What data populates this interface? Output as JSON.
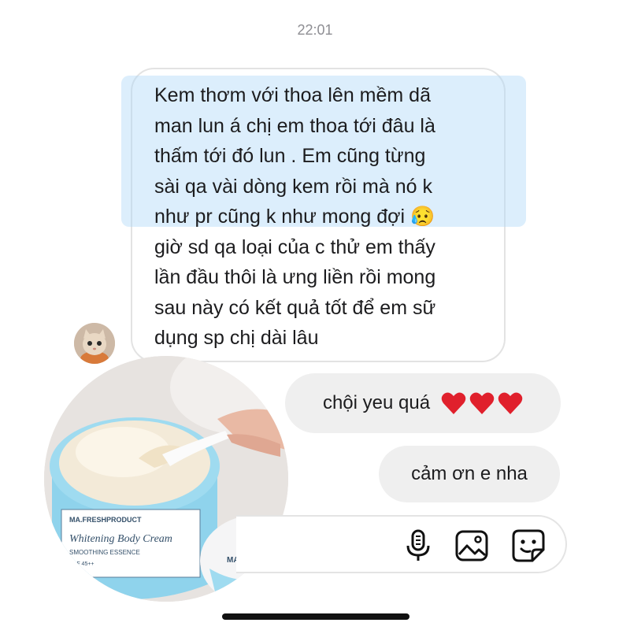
{
  "chat": {
    "timestamp": "22:01",
    "received_message": "Kem thơm với thoa lên mềm dã\nman lun á chị em thoa tới đâu là\nthấm tới đó lun . Em cũng từng\nsài qa vài dòng kem rồi mà nó k\nnhư pr cũng k như mong đợi 😥\ngiờ sd qa loại của c thử em thấy\nlần đầu thôi là ưng liền rồi mong\nsau này có kết quả tốt để em sữ\ndụng sp chị dài lâu",
    "sent_messages": [
      {
        "text": "chội yeu quá",
        "hearts": 3
      },
      {
        "text": "cảm ơn e nha"
      }
    ]
  },
  "photo": {
    "label_brand": "MA.FRESHPRODUCT",
    "label_line1": "Whitening Body Cream",
    "label_line2": "SMOOTHING ESSENCE",
    "label_line3": "SPF 45++",
    "lid_brand": "MA.FRESH"
  },
  "input_bar": {
    "icons": [
      "microphone-icon",
      "image-icon",
      "sticker-icon"
    ]
  },
  "colors": {
    "highlight": "#acd6f8",
    "bubble_gray": "#efefef",
    "heart_red": "#e0202c",
    "jar_blue": "#8fd3ec"
  }
}
